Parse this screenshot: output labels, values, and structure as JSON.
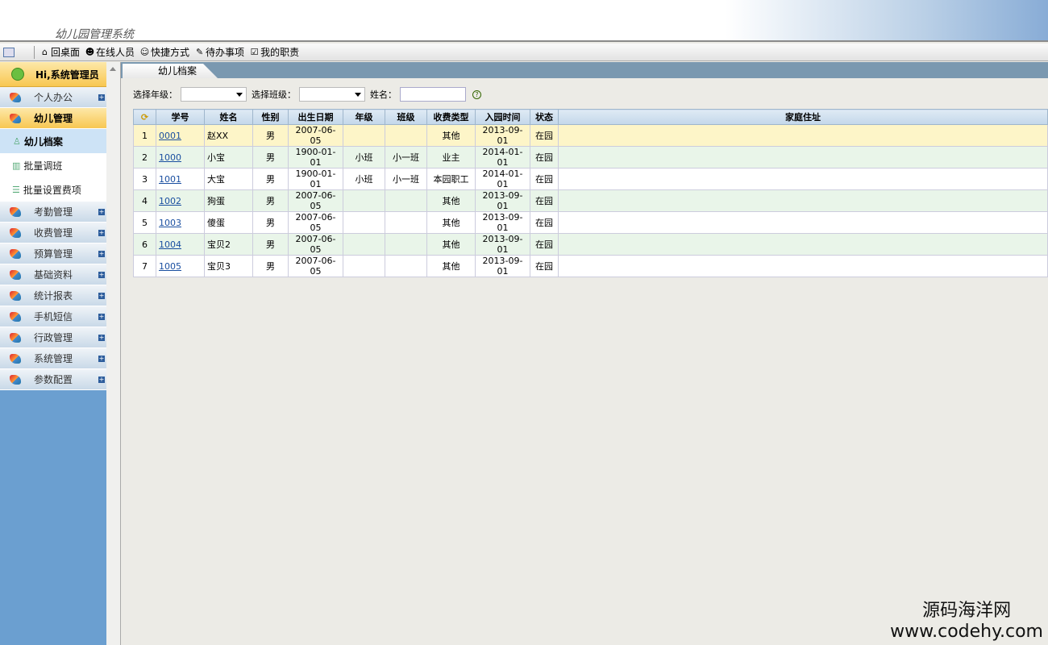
{
  "app": {
    "title": "幼儿园管理系统"
  },
  "toolbar": [
    {
      "icon": "home-icon",
      "label": "回桌面"
    },
    {
      "icon": "users-online-icon",
      "label": "在线人员"
    },
    {
      "icon": "smiley-icon",
      "label": "快捷方式"
    },
    {
      "icon": "notepad-icon",
      "label": "待办事项"
    },
    {
      "icon": "duty-icon",
      "label": "我的职责"
    }
  ],
  "sidebar": {
    "greeting": "Hi,系统管理员",
    "groups_top": [
      "个人办公"
    ],
    "active_group": "幼儿管理",
    "subitems": [
      {
        "label": "幼儿档案",
        "icon": "user-icon"
      },
      {
        "label": "批量调班",
        "icon": "bank-icon"
      },
      {
        "label": "批量设置费项",
        "icon": "settings-list-icon"
      }
    ],
    "groups_bottom": [
      "考勤管理",
      "收费管理",
      "预算管理",
      "基础资料",
      "统计报表",
      "手机短信",
      "行政管理",
      "系统管理",
      "参数配置"
    ]
  },
  "tab": {
    "label": "幼儿档案"
  },
  "filters": {
    "grade_label": "选择年级：",
    "class_label": "选择班级：",
    "name_label": "姓名：",
    "grade_value": "",
    "class_value": "",
    "name_value": ""
  },
  "table": {
    "headers": [
      "学号",
      "姓名",
      "性别",
      "出生日期",
      "年级",
      "班级",
      "收费类型",
      "入园时间",
      "状态",
      "家庭住址"
    ],
    "rows": [
      [
        "1",
        "0001",
        "赵XX",
        "男",
        "2007-06-05",
        "",
        "",
        "其他",
        "2013-09-01",
        "在园",
        ""
      ],
      [
        "2",
        "1000",
        "小宝",
        "男",
        "1900-01-01",
        "小班",
        "小一班",
        "业主",
        "2014-01-01",
        "在园",
        ""
      ],
      [
        "3",
        "1001",
        "大宝",
        "男",
        "1900-01-01",
        "小班",
        "小一班",
        "本园职工",
        "2014-01-01",
        "在园",
        ""
      ],
      [
        "4",
        "1002",
        "狗蛋",
        "男",
        "2007-06-05",
        "",
        "",
        "其他",
        "2013-09-01",
        "在园",
        ""
      ],
      [
        "5",
        "1003",
        "傻蛋",
        "男",
        "2007-06-05",
        "",
        "",
        "其他",
        "2013-09-01",
        "在园",
        ""
      ],
      [
        "6",
        "1004",
        "宝贝2",
        "男",
        "2007-06-05",
        "",
        "",
        "其他",
        "2013-09-01",
        "在园",
        ""
      ],
      [
        "7",
        "1005",
        "宝贝3",
        "男",
        "2007-06-05",
        "",
        "",
        "其他",
        "2013-09-01",
        "在园",
        ""
      ]
    ]
  },
  "watermark": {
    "line1": "源码海洋网",
    "line2": "www.codehy.com"
  }
}
